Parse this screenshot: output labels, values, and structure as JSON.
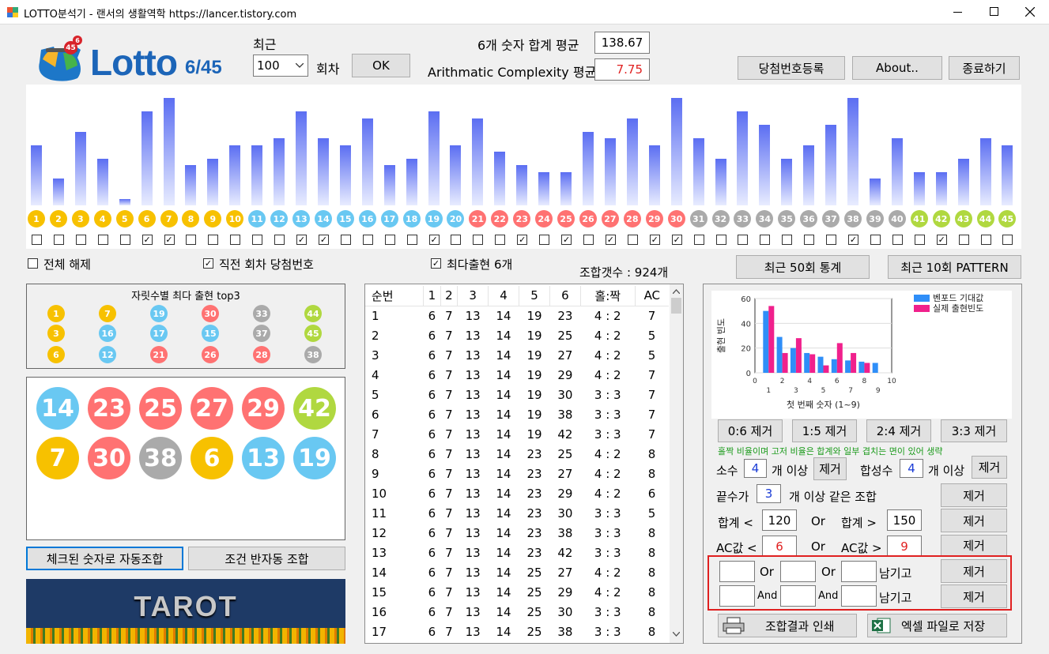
{
  "window": {
    "title": "LOTTO분석기  -  랜서의 생활역학 https://lancer.tistory.com"
  },
  "logo": {
    "text": "Lotto",
    "suffix": "6/45",
    "badge1": "45",
    "badge2": "6"
  },
  "recent": {
    "label": "최근",
    "value": "100",
    "unit": "회차",
    "ok": "OK"
  },
  "stats": {
    "sum_label": "6개 숫자 합계 평균",
    "sum_value": "138.67",
    "ac_label": "Arithmatic Complexity 평균",
    "ac_value": "7.75"
  },
  "buttons": {
    "register": "당첨번호등록",
    "about": "About..",
    "exit": "종료하기",
    "stats50": "최근 50회 통계",
    "pattern10": "최근 10회 PATTERN",
    "auto": "체크된 숫자로 자동조합",
    "semi": "조건 반자동 조합",
    "print": "조합결과 인쇄",
    "excel": "엑셀 파일로 저장"
  },
  "colors": {
    "yellow": "#f7c100",
    "blue": "#69c8f2",
    "red": "#ff7272",
    "gray": "#aaaaaa",
    "green": "#b0d840",
    "bar_top": "#5b6ef2",
    "bar_bottom": "#e8ecff"
  },
  "freq": {
    "heights": [
      9,
      4,
      11,
      7,
      1,
      14,
      16,
      6,
      7,
      9,
      9,
      10,
      14,
      10,
      9,
      13,
      6,
      7,
      14,
      9,
      13,
      8,
      6,
      5,
      5,
      11,
      10,
      13,
      9,
      16,
      10,
      7,
      14,
      12,
      7,
      9,
      12,
      16,
      4,
      10,
      5,
      5,
      7,
      10,
      9
    ]
  },
  "numbers": [
    {
      "n": "1",
      "c": "yellow",
      "checked": false
    },
    {
      "n": "2",
      "c": "yellow",
      "checked": false
    },
    {
      "n": "3",
      "c": "yellow",
      "checked": false
    },
    {
      "n": "4",
      "c": "yellow",
      "checked": false
    },
    {
      "n": "5",
      "c": "yellow",
      "checked": false
    },
    {
      "n": "6",
      "c": "yellow",
      "checked": true
    },
    {
      "n": "7",
      "c": "yellow",
      "checked": true
    },
    {
      "n": "8",
      "c": "yellow",
      "checked": false
    },
    {
      "n": "9",
      "c": "yellow",
      "checked": false
    },
    {
      "n": "10",
      "c": "yellow",
      "checked": false
    },
    {
      "n": "11",
      "c": "blue",
      "checked": false
    },
    {
      "n": "12",
      "c": "blue",
      "checked": false
    },
    {
      "n": "13",
      "c": "blue",
      "checked": true
    },
    {
      "n": "14",
      "c": "blue",
      "checked": true
    },
    {
      "n": "15",
      "c": "blue",
      "checked": false
    },
    {
      "n": "16",
      "c": "blue",
      "checked": false
    },
    {
      "n": "17",
      "c": "blue",
      "checked": false
    },
    {
      "n": "18",
      "c": "blue",
      "checked": false
    },
    {
      "n": "19",
      "c": "blue",
      "checked": true
    },
    {
      "n": "20",
      "c": "blue",
      "checked": false
    },
    {
      "n": "21",
      "c": "red",
      "checked": false
    },
    {
      "n": "22",
      "c": "red",
      "checked": false
    },
    {
      "n": "23",
      "c": "red",
      "checked": true
    },
    {
      "n": "24",
      "c": "red",
      "checked": false
    },
    {
      "n": "25",
      "c": "red",
      "checked": true
    },
    {
      "n": "26",
      "c": "red",
      "checked": false
    },
    {
      "n": "27",
      "c": "red",
      "checked": true
    },
    {
      "n": "28",
      "c": "red",
      "checked": false
    },
    {
      "n": "29",
      "c": "red",
      "checked": true
    },
    {
      "n": "30",
      "c": "red",
      "checked": true
    },
    {
      "n": "31",
      "c": "gray",
      "checked": false
    },
    {
      "n": "32",
      "c": "gray",
      "checked": false
    },
    {
      "n": "33",
      "c": "gray",
      "checked": false
    },
    {
      "n": "34",
      "c": "gray",
      "checked": false
    },
    {
      "n": "35",
      "c": "gray",
      "checked": false
    },
    {
      "n": "36",
      "c": "gray",
      "checked": false
    },
    {
      "n": "37",
      "c": "gray",
      "checked": false
    },
    {
      "n": "38",
      "c": "gray",
      "checked": true
    },
    {
      "n": "39",
      "c": "gray",
      "checked": false
    },
    {
      "n": "40",
      "c": "gray",
      "checked": false
    },
    {
      "n": "41",
      "c": "green",
      "checked": false
    },
    {
      "n": "42",
      "c": "green",
      "checked": true
    },
    {
      "n": "43",
      "c": "green",
      "checked": false
    },
    {
      "n": "44",
      "c": "green",
      "checked": false
    },
    {
      "n": "45",
      "c": "green",
      "checked": false
    }
  ],
  "options": {
    "clear_all": "전체 해제",
    "prev_win": "직전 회차 당첨번호",
    "top6": "최다출현 6개",
    "combo_count": "조합갯수 : 924개"
  },
  "top3": {
    "title": "자릿수별 최다 출현 top3",
    "rows": [
      [
        {
          "n": "1",
          "c": "yellow"
        },
        {
          "n": "7",
          "c": "yellow"
        },
        {
          "n": "19",
          "c": "blue"
        },
        {
          "n": "30",
          "c": "red"
        },
        {
          "n": "33",
          "c": "gray"
        },
        {
          "n": "44",
          "c": "green"
        }
      ],
      [
        {
          "n": "3",
          "c": "yellow"
        },
        {
          "n": "16",
          "c": "blue"
        },
        {
          "n": "17",
          "c": "blue"
        },
        {
          "n": "15",
          "c": "blue"
        },
        {
          "n": "37",
          "c": "gray"
        },
        {
          "n": "45",
          "c": "green"
        }
      ],
      [
        {
          "n": "6",
          "c": "yellow"
        },
        {
          "n": "12",
          "c": "blue"
        },
        {
          "n": "21",
          "c": "red"
        },
        {
          "n": "26",
          "c": "red"
        },
        {
          "n": "28",
          "c": "red"
        },
        {
          "n": "38",
          "c": "gray"
        }
      ]
    ]
  },
  "selected": [
    {
      "n": "14",
      "c": "blue"
    },
    {
      "n": "23",
      "c": "red"
    },
    {
      "n": "25",
      "c": "red"
    },
    {
      "n": "27",
      "c": "red"
    },
    {
      "n": "29",
      "c": "red"
    },
    {
      "n": "42",
      "c": "green"
    },
    {
      "n": "7",
      "c": "yellow"
    },
    {
      "n": "30",
      "c": "red"
    },
    {
      "n": "38",
      "c": "gray"
    },
    {
      "n": "6",
      "c": "yellow"
    },
    {
      "n": "13",
      "c": "blue"
    },
    {
      "n": "19",
      "c": "blue"
    }
  ],
  "tarot": "TAROT",
  "table": {
    "headers": [
      "순번",
      "1",
      "2",
      "3",
      "4",
      "5",
      "6",
      "홀:짝",
      "AC"
    ],
    "rows": [
      [
        "1",
        "6",
        "7",
        "13",
        "14",
        "19",
        "23",
        "4 : 2",
        "7"
      ],
      [
        "2",
        "6",
        "7",
        "13",
        "14",
        "19",
        "25",
        "4 : 2",
        "5"
      ],
      [
        "3",
        "6",
        "7",
        "13",
        "14",
        "19",
        "27",
        "4 : 2",
        "5"
      ],
      [
        "4",
        "6",
        "7",
        "13",
        "14",
        "19",
        "29",
        "4 : 2",
        "7"
      ],
      [
        "5",
        "6",
        "7",
        "13",
        "14",
        "19",
        "30",
        "3 : 3",
        "7"
      ],
      [
        "6",
        "6",
        "7",
        "13",
        "14",
        "19",
        "38",
        "3 : 3",
        "7"
      ],
      [
        "7",
        "6",
        "7",
        "13",
        "14",
        "19",
        "42",
        "3 : 3",
        "7"
      ],
      [
        "8",
        "6",
        "7",
        "13",
        "14",
        "23",
        "25",
        "4 : 2",
        "8"
      ],
      [
        "9",
        "6",
        "7",
        "13",
        "14",
        "23",
        "27",
        "4 : 2",
        "8"
      ],
      [
        "10",
        "6",
        "7",
        "13",
        "14",
        "23",
        "29",
        "4 : 2",
        "6"
      ],
      [
        "11",
        "6",
        "7",
        "13",
        "14",
        "23",
        "30",
        "3 : 3",
        "5"
      ],
      [
        "12",
        "6",
        "7",
        "13",
        "14",
        "23",
        "38",
        "3 : 3",
        "8"
      ],
      [
        "13",
        "6",
        "7",
        "13",
        "14",
        "23",
        "42",
        "3 : 3",
        "8"
      ],
      [
        "14",
        "6",
        "7",
        "13",
        "14",
        "25",
        "27",
        "4 : 2",
        "8"
      ],
      [
        "15",
        "6",
        "7",
        "13",
        "14",
        "25",
        "29",
        "4 : 2",
        "8"
      ],
      [
        "16",
        "6",
        "7",
        "13",
        "14",
        "25",
        "30",
        "3 : 3",
        "8"
      ],
      [
        "17",
        "6",
        "7",
        "13",
        "14",
        "25",
        "38",
        "3 : 3",
        "8"
      ]
    ]
  },
  "chart_data": {
    "type": "bar",
    "categories": [
      "1",
      "2",
      "3",
      "4",
      "5",
      "6",
      "7",
      "8",
      "9"
    ],
    "series": [
      {
        "name": "벤포드 기대값",
        "color": "#2f8ef8",
        "values": [
          50,
          29,
          20,
          16,
          13,
          11,
          10,
          9,
          8
        ]
      },
      {
        "name": "실제 출현빈도",
        "color": "#f0208c",
        "values": [
          54,
          16,
          28,
          15,
          6,
          24,
          16,
          8,
          0
        ]
      }
    ],
    "ylim": [
      0,
      60
    ],
    "yticks": [
      "0",
      "20",
      "40",
      "60"
    ],
    "xticks": [
      "0",
      "2",
      "4",
      "6",
      "8",
      "10"
    ],
    "xticks2": [
      "1",
      "3",
      "5",
      "7",
      "9"
    ],
    "ylabel": "출현 빈도",
    "xlabel": "첫 번째 숫자 (1~9)"
  },
  "filters": {
    "r06": "0:6 제거",
    "r15": "1:5 제거",
    "r24": "2:4 제거",
    "r33": "3:3 제거",
    "note": "홀짝 비율이며 고저 비율은 합계와 일부 겹치는 면이 있어 생략",
    "prime_label": "소수",
    "prime_val": "4",
    "above": "개 이상",
    "remove": "제거",
    "comp_label": "합성수",
    "comp_val": "4",
    "ending_label": "끝수가",
    "ending_val": "3",
    "ending_suffix": "개 이상 같은 조합",
    "sum_lt": "합계 <",
    "sum_lt_val": "120",
    "or": "Or",
    "sum_gt": "합계 >",
    "sum_gt_val": "150",
    "ac_lt": "AC값 <",
    "ac_lt_val": "6",
    "ac_gt": "AC값 >",
    "ac_gt_val": "9",
    "keep": "남기고",
    "and": "And"
  }
}
